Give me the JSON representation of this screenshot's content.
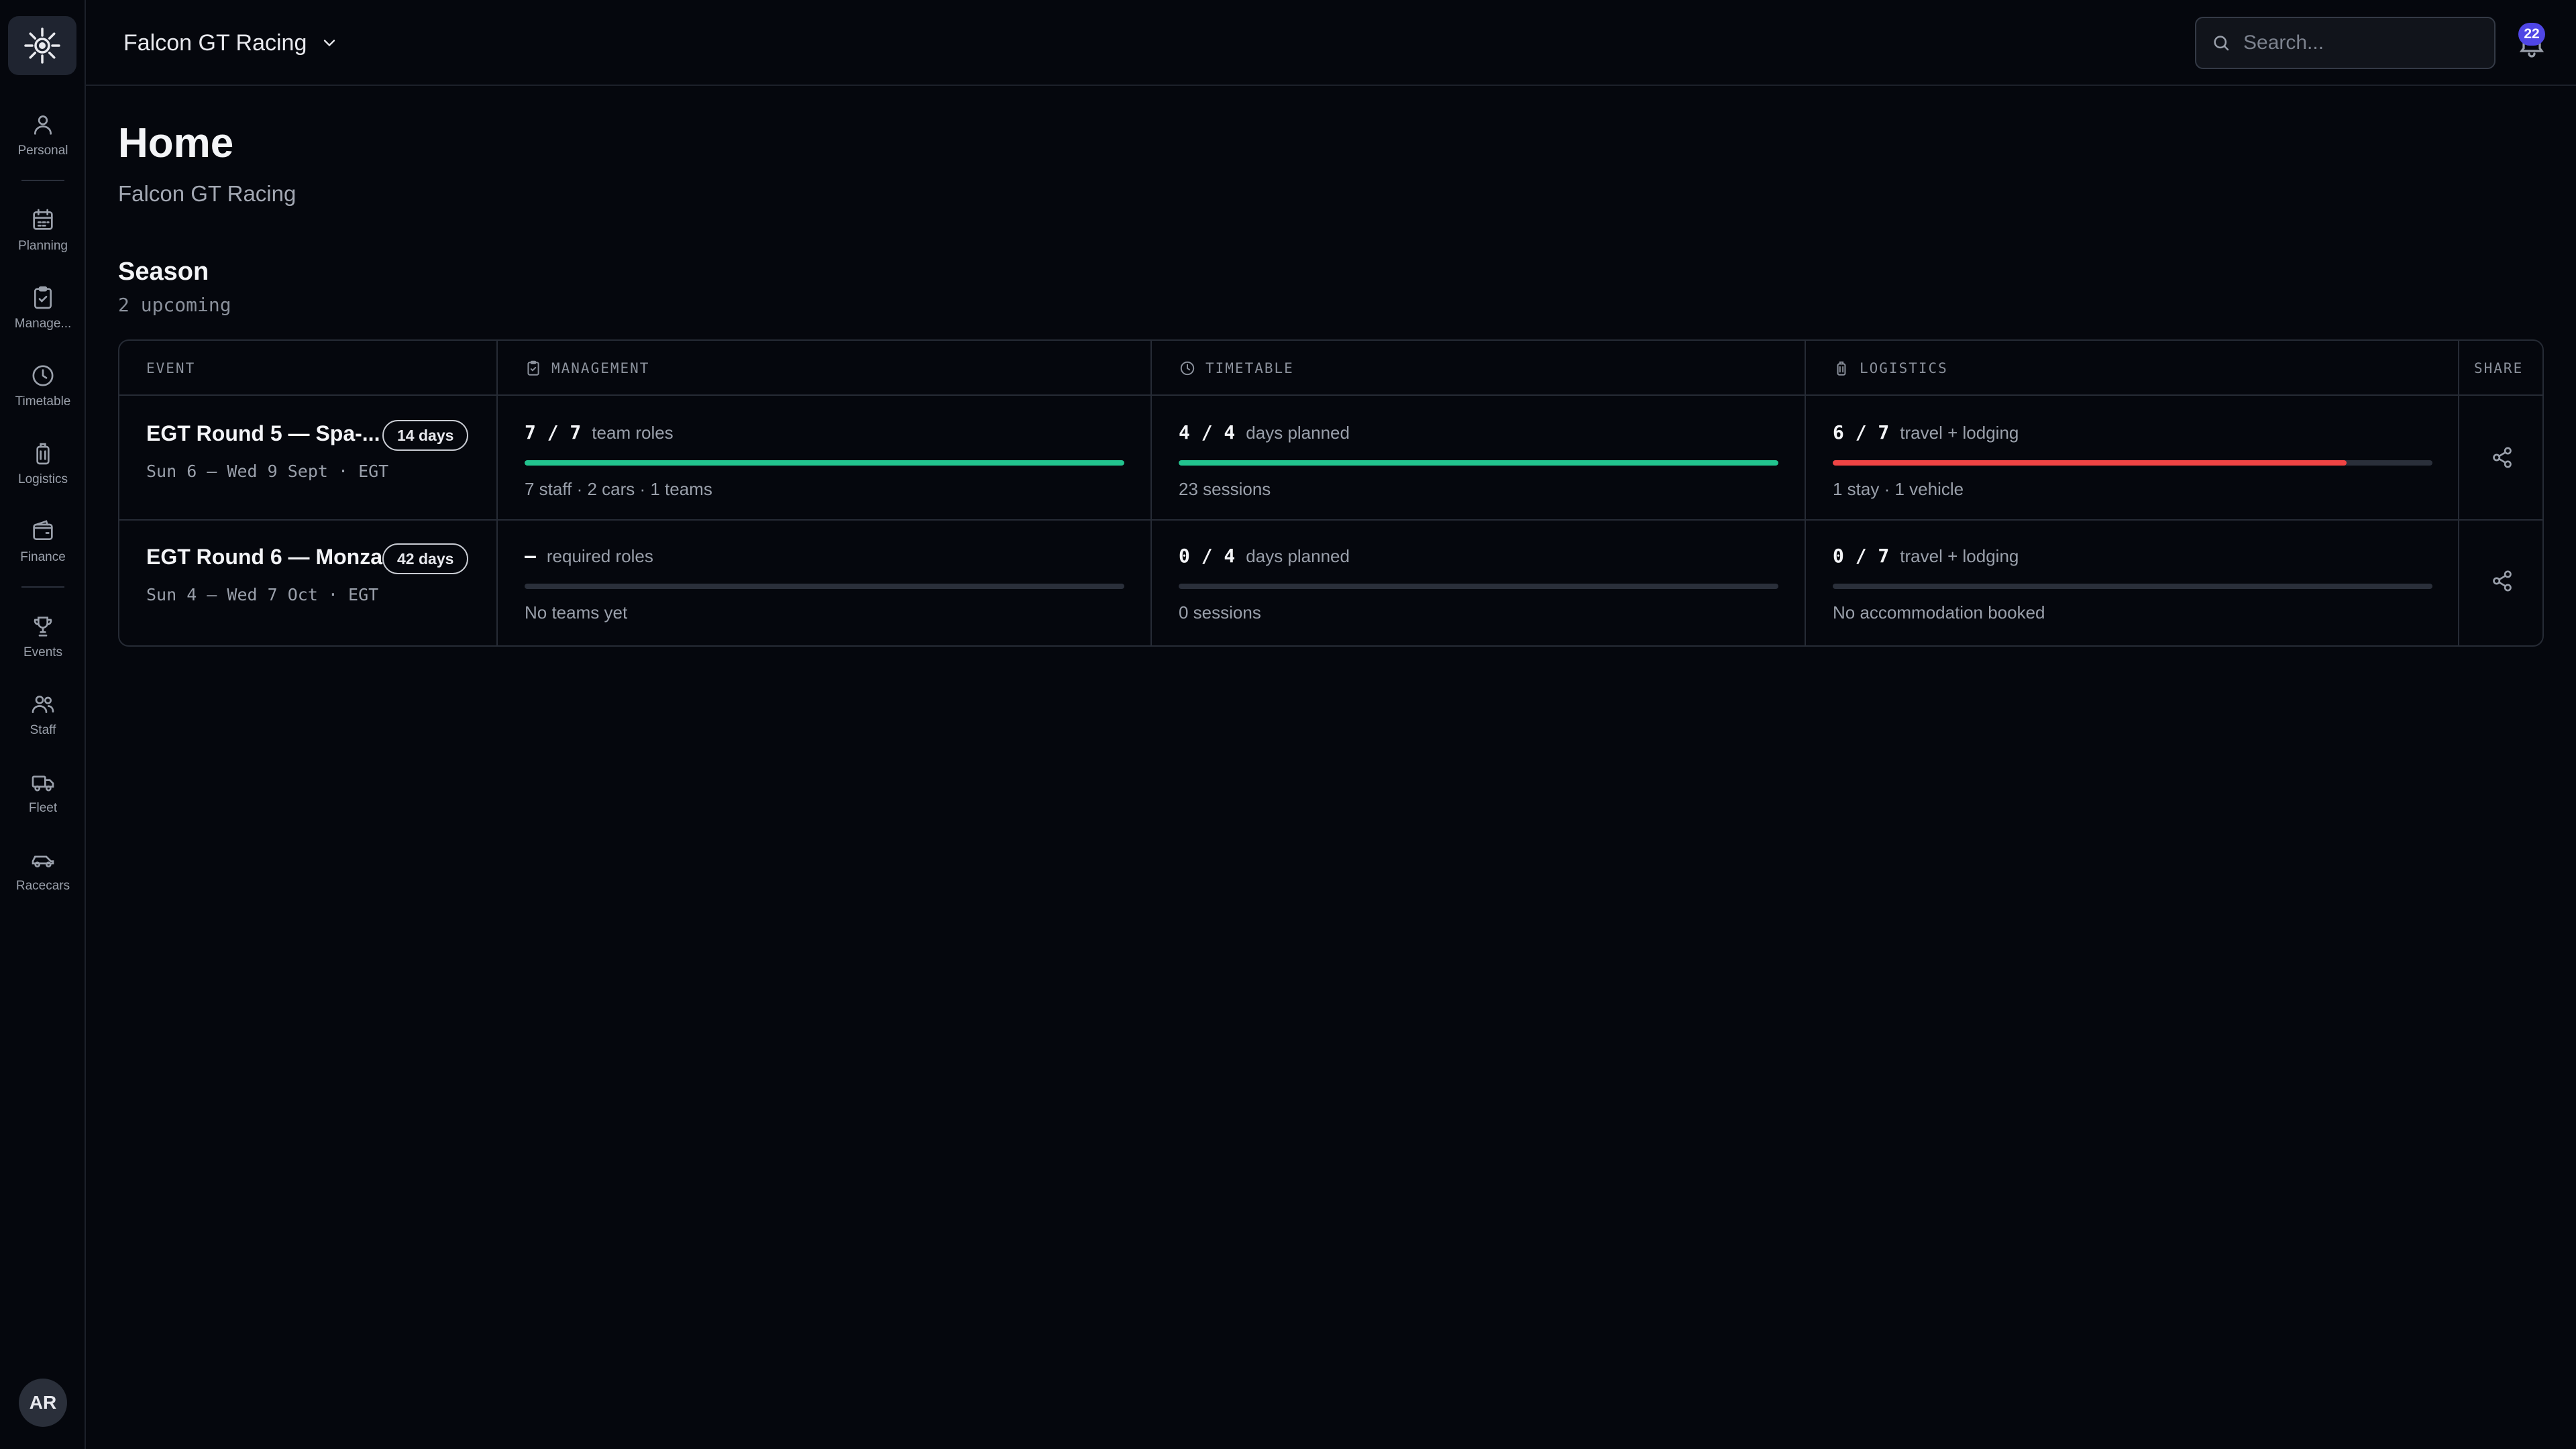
{
  "sidebar": {
    "items": [
      {
        "label": "Personal",
        "icon": "person-icon"
      },
      {
        "label": "Planning",
        "icon": "calendar-icon"
      },
      {
        "label": "Manage...",
        "icon": "clipboard-check-icon"
      },
      {
        "label": "Timetable",
        "icon": "clock-icon"
      },
      {
        "label": "Logistics",
        "icon": "luggage-icon"
      },
      {
        "label": "Finance",
        "icon": "wallet-icon"
      },
      {
        "label": "Events",
        "icon": "trophy-icon"
      },
      {
        "label": "Staff",
        "icon": "users-icon"
      },
      {
        "label": "Fleet",
        "icon": "truck-icon"
      },
      {
        "label": "Racecars",
        "icon": "car-icon"
      }
    ],
    "avatar_initials": "AR"
  },
  "header": {
    "team_name": "Falcon GT Racing",
    "search_placeholder": "Search...",
    "notification_count": "22"
  },
  "page": {
    "title": "Home",
    "subtitle": "Falcon GT Racing"
  },
  "season": {
    "title": "Season",
    "subtitle": "2 upcoming"
  },
  "table": {
    "columns": {
      "event": "EVENT",
      "management": "MANAGEMENT",
      "timetable": "TIMETABLE",
      "logistics": "LOGISTICS",
      "share": "SHARE"
    },
    "rows": [
      {
        "name": "EGT Round 5 — Spa-...",
        "days": "14 days",
        "dates": "Sun 6 – Wed 9 Sept · EGT",
        "management": {
          "value": "7 / 7",
          "unit": "team roles",
          "note": "7 staff · 2 cars · 1 teams",
          "progress": 1.0,
          "color": "#22c38e"
        },
        "timetable": {
          "value": "4 / 4",
          "unit": "days planned",
          "note": "23 sessions",
          "progress": 1.0,
          "color": "#22c38e"
        },
        "logistics": {
          "value": "6 / 7",
          "unit": "travel + lodging",
          "note": "1 stay · 1 vehicle",
          "progress": 0.857,
          "color": "#ef4444"
        }
      },
      {
        "name": "EGT Round 6 — Monza",
        "days": "42 days",
        "dates": "Sun 4 – Wed 7 Oct · EGT",
        "management": {
          "value": "–",
          "unit": "required roles",
          "note": "No teams yet",
          "progress": 0,
          "color": "#22c38e"
        },
        "timetable": {
          "value": "0 / 4",
          "unit": "days planned",
          "note": "0 sessions",
          "progress": 0,
          "color": "#22c38e"
        },
        "logistics": {
          "value": "0 / 7",
          "unit": "travel + lodging",
          "note": "No accommodation booked",
          "progress": 0,
          "color": "#ef4444"
        }
      }
    ]
  },
  "colors": {
    "background": "#05070d",
    "accent": "#4f46e5",
    "success": "#22c38e",
    "danger": "#ef4444"
  }
}
